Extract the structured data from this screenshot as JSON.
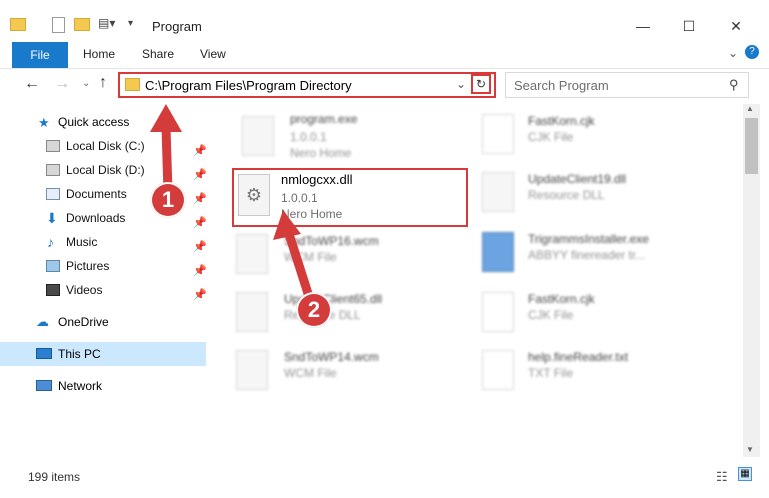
{
  "window": {
    "title": "Program",
    "minimize": "—",
    "maximize": "☐",
    "close": "✕"
  },
  "ribbon": {
    "file": "File",
    "home": "Home",
    "share": "Share",
    "view": "View"
  },
  "nav": {
    "address": "C:\\Program Files\\Program Directory",
    "search_placeholder": "Search Program"
  },
  "sidebar": {
    "quick_access": "Quick access",
    "items": [
      {
        "label": "Local Disk (C:)",
        "icon": "drive-icon"
      },
      {
        "label": "Local Disk (D:)",
        "icon": "drive-icon"
      },
      {
        "label": "Documents",
        "icon": "documents-icon"
      },
      {
        "label": "Downloads",
        "icon": "downloads-icon"
      },
      {
        "label": "Music",
        "icon": "music-icon"
      },
      {
        "label": "Pictures",
        "icon": "pictures-icon"
      },
      {
        "label": "Videos",
        "icon": "videos-icon"
      }
    ],
    "onedrive": "OneDrive",
    "this_pc": "This PC",
    "network": "Network"
  },
  "files": {
    "program_exe": {
      "name": "program.exe",
      "version": "1.0.0.1",
      "company": "Nero Home"
    },
    "highlighted": {
      "name": "nmlogcxx.dll",
      "version": "1.0.0.1",
      "company": "Nero Home"
    },
    "f3": {
      "name": "SndToWP16.wcm",
      "sub": "WCM File"
    },
    "f4": {
      "name": "UpdateClient65.dll",
      "sub": "Resource DLL"
    },
    "f5": {
      "name": "SndToWP14.wcm",
      "sub": "WCM File"
    },
    "r1": {
      "name": "FastKorn.cjk",
      "sub": "CJK File"
    },
    "r2": {
      "name": "UpdateClient19.dll",
      "sub": "Resource DLL"
    },
    "r3": {
      "name": "TrigrammsInstaller.exe",
      "sub": "ABBYY finereader tr..."
    },
    "r4": {
      "name": "FastKorn.cjk",
      "sub": "CJK File"
    },
    "r5": {
      "name": "help.fineReader.txt",
      "sub": "TXT File"
    }
  },
  "annotations": {
    "step1": "1",
    "step2": "2"
  },
  "status": {
    "item_count": "199 items"
  },
  "colors": {
    "accent": "#1979ca",
    "highlight": "#d83a3a",
    "selection": "#cce8ff"
  }
}
